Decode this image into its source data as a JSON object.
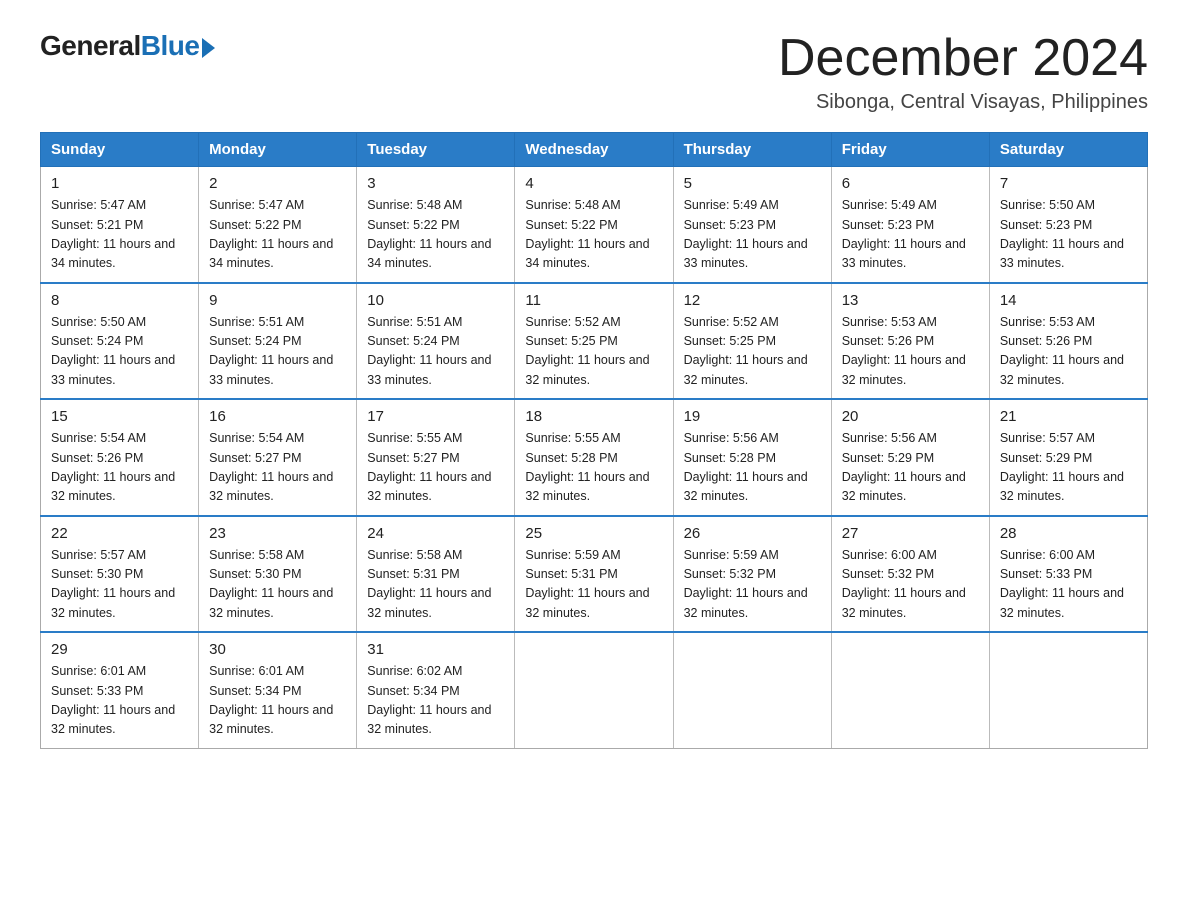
{
  "logo": {
    "general": "General",
    "blue": "Blue"
  },
  "title": {
    "month_year": "December 2024",
    "location": "Sibonga, Central Visayas, Philippines"
  },
  "days_of_week": [
    "Sunday",
    "Monday",
    "Tuesday",
    "Wednesday",
    "Thursday",
    "Friday",
    "Saturday"
  ],
  "weeks": [
    [
      {
        "date": "1",
        "sunrise": "Sunrise: 5:47 AM",
        "sunset": "Sunset: 5:21 PM",
        "daylight": "Daylight: 11 hours and 34 minutes."
      },
      {
        "date": "2",
        "sunrise": "Sunrise: 5:47 AM",
        "sunset": "Sunset: 5:22 PM",
        "daylight": "Daylight: 11 hours and 34 minutes."
      },
      {
        "date": "3",
        "sunrise": "Sunrise: 5:48 AM",
        "sunset": "Sunset: 5:22 PM",
        "daylight": "Daylight: 11 hours and 34 minutes."
      },
      {
        "date": "4",
        "sunrise": "Sunrise: 5:48 AM",
        "sunset": "Sunset: 5:22 PM",
        "daylight": "Daylight: 11 hours and 34 minutes."
      },
      {
        "date": "5",
        "sunrise": "Sunrise: 5:49 AM",
        "sunset": "Sunset: 5:23 PM",
        "daylight": "Daylight: 11 hours and 33 minutes."
      },
      {
        "date": "6",
        "sunrise": "Sunrise: 5:49 AM",
        "sunset": "Sunset: 5:23 PM",
        "daylight": "Daylight: 11 hours and 33 minutes."
      },
      {
        "date": "7",
        "sunrise": "Sunrise: 5:50 AM",
        "sunset": "Sunset: 5:23 PM",
        "daylight": "Daylight: 11 hours and 33 minutes."
      }
    ],
    [
      {
        "date": "8",
        "sunrise": "Sunrise: 5:50 AM",
        "sunset": "Sunset: 5:24 PM",
        "daylight": "Daylight: 11 hours and 33 minutes."
      },
      {
        "date": "9",
        "sunrise": "Sunrise: 5:51 AM",
        "sunset": "Sunset: 5:24 PM",
        "daylight": "Daylight: 11 hours and 33 minutes."
      },
      {
        "date": "10",
        "sunrise": "Sunrise: 5:51 AM",
        "sunset": "Sunset: 5:24 PM",
        "daylight": "Daylight: 11 hours and 33 minutes."
      },
      {
        "date": "11",
        "sunrise": "Sunrise: 5:52 AM",
        "sunset": "Sunset: 5:25 PM",
        "daylight": "Daylight: 11 hours and 32 minutes."
      },
      {
        "date": "12",
        "sunrise": "Sunrise: 5:52 AM",
        "sunset": "Sunset: 5:25 PM",
        "daylight": "Daylight: 11 hours and 32 minutes."
      },
      {
        "date": "13",
        "sunrise": "Sunrise: 5:53 AM",
        "sunset": "Sunset: 5:26 PM",
        "daylight": "Daylight: 11 hours and 32 minutes."
      },
      {
        "date": "14",
        "sunrise": "Sunrise: 5:53 AM",
        "sunset": "Sunset: 5:26 PM",
        "daylight": "Daylight: 11 hours and 32 minutes."
      }
    ],
    [
      {
        "date": "15",
        "sunrise": "Sunrise: 5:54 AM",
        "sunset": "Sunset: 5:26 PM",
        "daylight": "Daylight: 11 hours and 32 minutes."
      },
      {
        "date": "16",
        "sunrise": "Sunrise: 5:54 AM",
        "sunset": "Sunset: 5:27 PM",
        "daylight": "Daylight: 11 hours and 32 minutes."
      },
      {
        "date": "17",
        "sunrise": "Sunrise: 5:55 AM",
        "sunset": "Sunset: 5:27 PM",
        "daylight": "Daylight: 11 hours and 32 minutes."
      },
      {
        "date": "18",
        "sunrise": "Sunrise: 5:55 AM",
        "sunset": "Sunset: 5:28 PM",
        "daylight": "Daylight: 11 hours and 32 minutes."
      },
      {
        "date": "19",
        "sunrise": "Sunrise: 5:56 AM",
        "sunset": "Sunset: 5:28 PM",
        "daylight": "Daylight: 11 hours and 32 minutes."
      },
      {
        "date": "20",
        "sunrise": "Sunrise: 5:56 AM",
        "sunset": "Sunset: 5:29 PM",
        "daylight": "Daylight: 11 hours and 32 minutes."
      },
      {
        "date": "21",
        "sunrise": "Sunrise: 5:57 AM",
        "sunset": "Sunset: 5:29 PM",
        "daylight": "Daylight: 11 hours and 32 minutes."
      }
    ],
    [
      {
        "date": "22",
        "sunrise": "Sunrise: 5:57 AM",
        "sunset": "Sunset: 5:30 PM",
        "daylight": "Daylight: 11 hours and 32 minutes."
      },
      {
        "date": "23",
        "sunrise": "Sunrise: 5:58 AM",
        "sunset": "Sunset: 5:30 PM",
        "daylight": "Daylight: 11 hours and 32 minutes."
      },
      {
        "date": "24",
        "sunrise": "Sunrise: 5:58 AM",
        "sunset": "Sunset: 5:31 PM",
        "daylight": "Daylight: 11 hours and 32 minutes."
      },
      {
        "date": "25",
        "sunrise": "Sunrise: 5:59 AM",
        "sunset": "Sunset: 5:31 PM",
        "daylight": "Daylight: 11 hours and 32 minutes."
      },
      {
        "date": "26",
        "sunrise": "Sunrise: 5:59 AM",
        "sunset": "Sunset: 5:32 PM",
        "daylight": "Daylight: 11 hours and 32 minutes."
      },
      {
        "date": "27",
        "sunrise": "Sunrise: 6:00 AM",
        "sunset": "Sunset: 5:32 PM",
        "daylight": "Daylight: 11 hours and 32 minutes."
      },
      {
        "date": "28",
        "sunrise": "Sunrise: 6:00 AM",
        "sunset": "Sunset: 5:33 PM",
        "daylight": "Daylight: 11 hours and 32 minutes."
      }
    ],
    [
      {
        "date": "29",
        "sunrise": "Sunrise: 6:01 AM",
        "sunset": "Sunset: 5:33 PM",
        "daylight": "Daylight: 11 hours and 32 minutes."
      },
      {
        "date": "30",
        "sunrise": "Sunrise: 6:01 AM",
        "sunset": "Sunset: 5:34 PM",
        "daylight": "Daylight: 11 hours and 32 minutes."
      },
      {
        "date": "31",
        "sunrise": "Sunrise: 6:02 AM",
        "sunset": "Sunset: 5:34 PM",
        "daylight": "Daylight: 11 hours and 32 minutes."
      },
      null,
      null,
      null,
      null
    ]
  ]
}
